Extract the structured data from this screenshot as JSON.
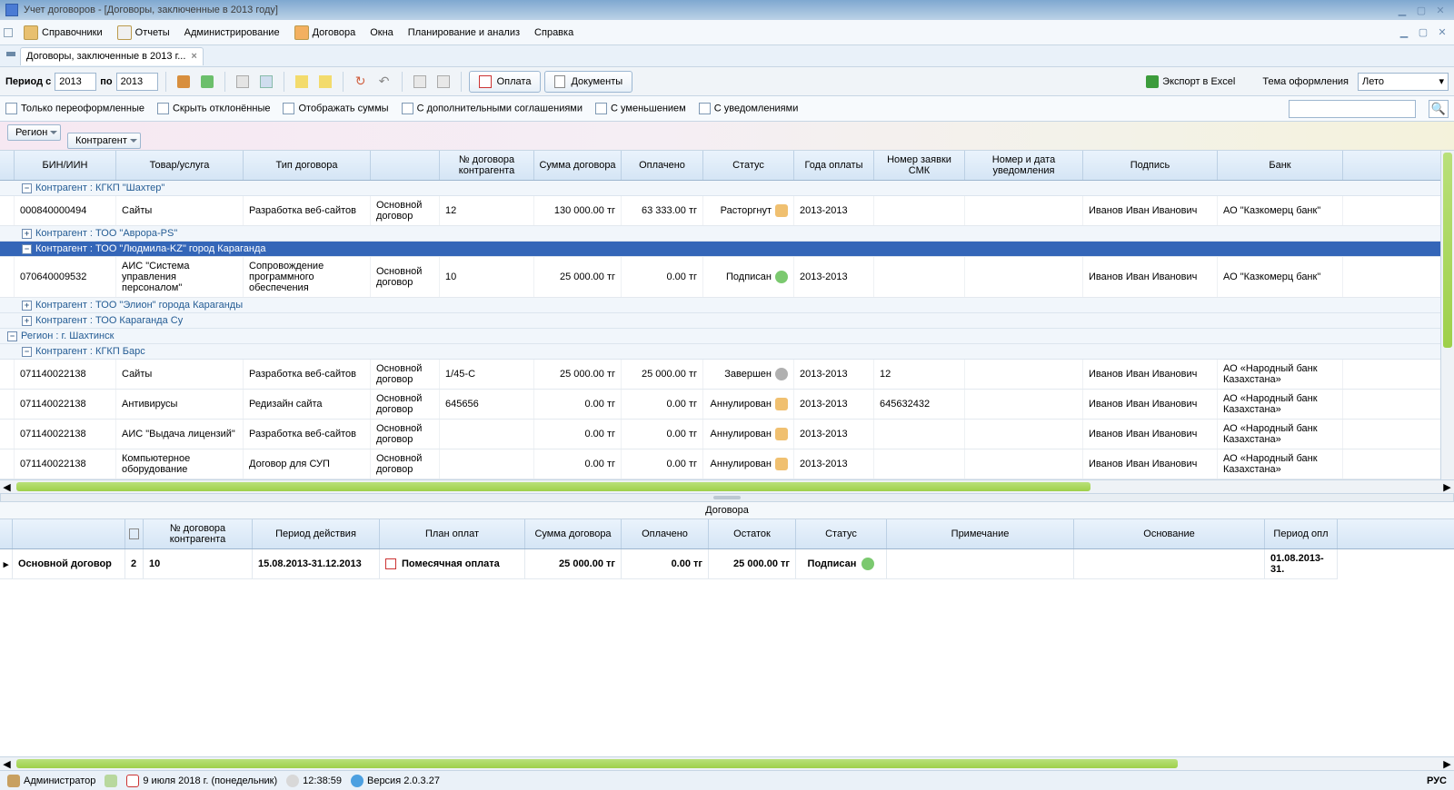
{
  "titlebar": {
    "title": "Учет договоров - [Договоры, заключенные в 2013 году]"
  },
  "menu": {
    "items": [
      "Справочники",
      "Отчеты",
      "Администрирование",
      "Договора",
      "Окна",
      "Планирование и анализ",
      "Справка"
    ]
  },
  "tab": {
    "label": "Договоры, заключенные в 2013 г..."
  },
  "period": {
    "label_from": "Период с",
    "from": "2013",
    "label_to": "по",
    "to": "2013"
  },
  "toolbar": {
    "pay": "Оплата",
    "docs": "Документы",
    "export": "Экспорт в Excel",
    "theme_label": "Тема оформления",
    "theme_value": "Лето"
  },
  "filters": {
    "only_re": "Только переоформленные",
    "hide_decl": "Скрыть отклонённые",
    "show_sums": "Отображать суммы",
    "with_add": "С дополнительными соглашениями",
    "with_dec": "С уменьшением",
    "with_notif": "С уведомлениями"
  },
  "group": {
    "pill1": "Регион",
    "pill2": "Контрагент"
  },
  "grid": {
    "headers": [
      "БИН/ИИН",
      "Товар/услуга",
      "Тип договора",
      "",
      "№ договора контрагента",
      "Сумма договора",
      "Оплачено",
      "Статус",
      "Года оплаты",
      "Номер заявки СМК",
      "Номер и дата уведомления",
      "Подпись",
      "Банк"
    ],
    "groups": {
      "g1": "Контрагент : КГКП \"Шахтер\"",
      "g2": "Контрагент : ТОО \"Аврора-PS\"",
      "g3": "Контрагент : ТОО \"Людмила-KZ\" город Караганда",
      "g4": "Контрагент : ТОО \"Элион\" города Караганды",
      "g5": "Контрагент : ТОО Караганда Су",
      "r1": "Регион : г. Шахтинск",
      "g6": "Контрагент : КГКП Барс"
    },
    "r1": {
      "bin": "000840000494",
      "prod": "Сайты",
      "type": "Разработка веб-сайтов",
      "kind": "Основной договор",
      "num": "12",
      "sum": "130 000.00 тг",
      "paid": "63 333.00 тг",
      "status": "Расторгнут",
      "years": "2013-2013",
      "smk": "",
      "notif": "",
      "sign": "Иванов Иван Иванович",
      "bank": "АО \"Казкомерц банк\""
    },
    "r2": {
      "bin": "070640009532",
      "prod": "АИС \"Система управления персоналом\"",
      "type": "Сопровождение программного обеспечения",
      "kind": "Основной договор",
      "num": "10",
      "sum": "25 000.00 тг",
      "paid": "0.00 тг",
      "status": "Подписан",
      "years": "2013-2013",
      "smk": "",
      "notif": "",
      "sign": "Иванов Иван Иванович",
      "bank": "АО \"Казкомерц банк\""
    },
    "r3": {
      "bin": "071140022138",
      "prod": "Сайты",
      "type": "Разработка веб-сайтов",
      "kind": "Основной договор",
      "num": "1/45-С",
      "sum": "25 000.00 тг",
      "paid": "25 000.00 тг",
      "status": "Завершен",
      "years": "2013-2013",
      "smk": "12",
      "notif": "",
      "sign": "Иванов Иван Иванович",
      "bank": "АО «Народный банк Казахстана»"
    },
    "r4": {
      "bin": "071140022138",
      "prod": "Антивирусы",
      "type": "Редизайн сайта",
      "kind": "Основной договор",
      "num": "645656",
      "sum": "0.00 тг",
      "paid": "0.00 тг",
      "status": "Аннулирован",
      "years": "2013-2013",
      "smk": "645632432",
      "notif": "",
      "sign": "Иванов Иван Иванович",
      "bank": "АО «Народный банк Казахстана»"
    },
    "r5": {
      "bin": "071140022138",
      "prod": "АИС \"Выдача лицензий\"",
      "type": "Разработка веб-сайтов",
      "kind": "Основной договор",
      "num": "",
      "sum": "0.00 тг",
      "paid": "0.00 тг",
      "status": "Аннулирован",
      "years": "2013-2013",
      "smk": "",
      "notif": "",
      "sign": "Иванов Иван Иванович",
      "bank": "АО «Народный банк Казахстана»"
    },
    "r6": {
      "bin": "071140022138",
      "prod": "Компьютерное оборудование",
      "type": "Договор для СУП",
      "kind": "Основной договор",
      "num": "",
      "sum": "0.00 тг",
      "paid": "0.00 тг",
      "status": "Аннулирован",
      "years": "2013-2013",
      "smk": "",
      "notif": "",
      "sign": "Иванов Иван Иванович",
      "bank": "АО «Народный банк Казахстана»"
    }
  },
  "detail": {
    "title": "Договора",
    "headers": [
      "",
      "",
      "№ договора контрагента",
      "Период действия",
      "План оплат",
      "Сумма договора",
      "Оплачено",
      "Остаток",
      "Статус",
      "Примечание",
      "Основание",
      "Период опл"
    ],
    "row": {
      "kind": "Основной договор",
      "icon": "2",
      "num": "10",
      "period": "15.08.2013-31.12.2013",
      "plan": "Помесячная оплата",
      "sum": "25 000.00 тг",
      "paid": "0.00 тг",
      "rest": "25 000.00 тг",
      "status": "Подписан",
      "note": "",
      "base": "",
      "pp": "01.08.2013-31."
    }
  },
  "status": {
    "user": "Администратор",
    "date": "9 июля 2018 г. (понедельник)",
    "time": "12:38:59",
    "ver": "Версия 2.0.3.27",
    "lang": "РУС"
  }
}
